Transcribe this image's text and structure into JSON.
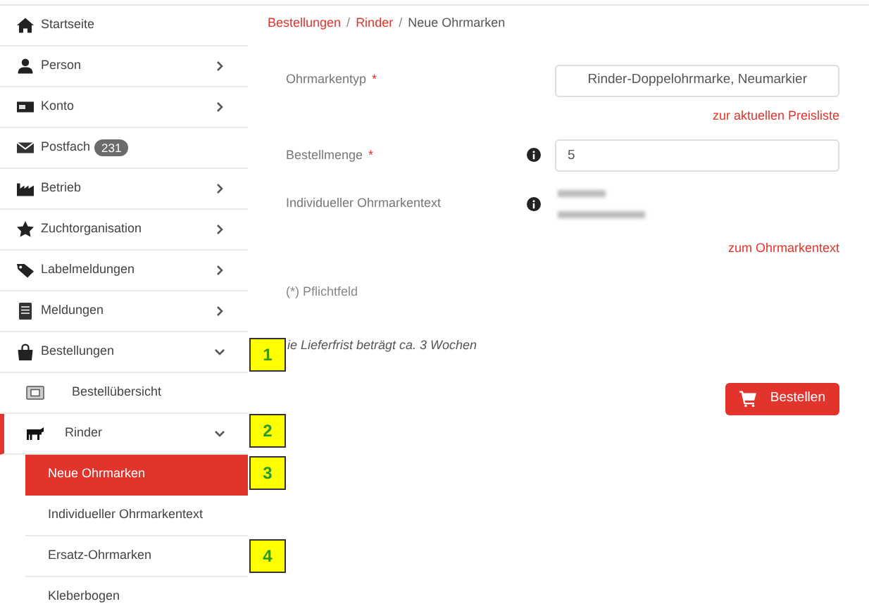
{
  "sidebar": {
    "items": [
      {
        "label": "Startseite",
        "selected": false
      },
      {
        "label": "Person",
        "selected": false,
        "expanded": false
      },
      {
        "label": "Konto",
        "selected": false,
        "expanded": false
      },
      {
        "label": "Postfach",
        "badge": "231",
        "selected": false
      },
      {
        "label": "Betrieb",
        "selected": false,
        "expanded": false
      },
      {
        "label": "Zuchtorganisation",
        "selected": false,
        "expanded": false
      },
      {
        "label": "Labelmeldungen",
        "selected": false,
        "expanded": false
      },
      {
        "label": "Meldungen",
        "selected": false,
        "expanded": false
      },
      {
        "label": "Bestellungen",
        "selected": false,
        "expanded": true,
        "children": [
          {
            "label": "Bestellübersicht",
            "selected": false
          },
          {
            "label": "Rinder",
            "selected": false,
            "expanded": true,
            "children": [
              {
                "label": "Neue Ohrmarken",
                "selected": true
              },
              {
                "label": "Individueller Ohrmarkentext",
                "selected": false
              },
              {
                "label": "Ersatz-Ohrmarken",
                "selected": false
              },
              {
                "label": "Kleberbogen",
                "selected": false
              }
            ]
          }
        ]
      }
    ]
  },
  "breadcrumb": [
    {
      "kind": "link",
      "label": "Bestellungen"
    },
    {
      "kind": "separator",
      "label": "/"
    },
    {
      "kind": "link",
      "label": "Rinder"
    },
    {
      "kind": "separator",
      "label": "/"
    },
    {
      "kind": "current",
      "label": "Neue Ohrmarken"
    }
  ],
  "form": {
    "fields": [
      {
        "kind": "select",
        "label": "Ohrmarkentyp",
        "required_mark": "*",
        "value": "Rinder-Doppelohrmarke, Neumarkier",
        "link": "zur aktuellen Preisliste"
      },
      {
        "kind": "input",
        "label": "Bestellmenge",
        "required_mark": "*",
        "info": true,
        "value": "5"
      },
      {
        "kind": "redacted",
        "label": "Individueller Ohrmarkentext",
        "info": true,
        "link": "zum Ohrmarkentext"
      }
    ],
    "required_note": "(*) Pflichtfeld",
    "delivery_note": "ie Lieferfrist beträgt ca. 3 Wochen",
    "submit": "Bestellen"
  },
  "callouts": [
    {
      "number": "1"
    },
    {
      "number": "2"
    },
    {
      "number": "3"
    },
    {
      "number": "4"
    }
  ]
}
